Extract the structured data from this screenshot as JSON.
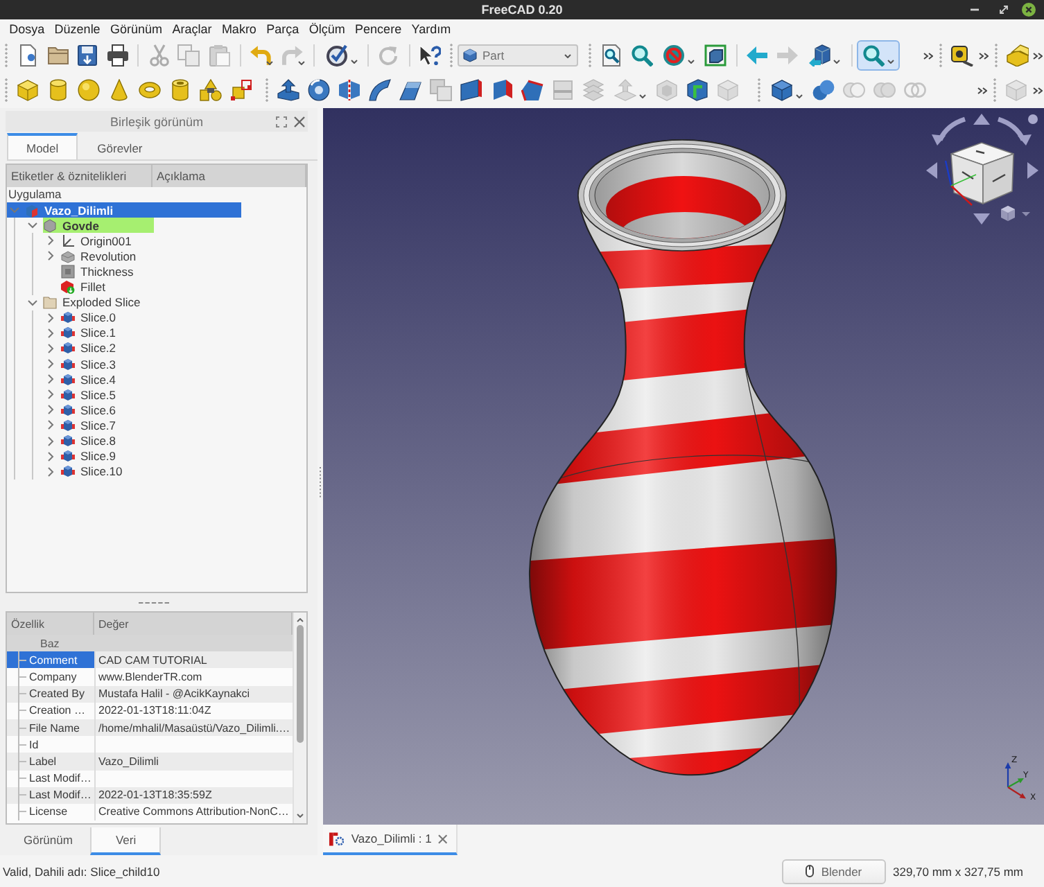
{
  "window": {
    "title": "FreeCAD 0.20"
  },
  "menu": [
    "Dosya",
    "Düzenle",
    "Görünüm",
    "Araçlar",
    "Makro",
    "Parça",
    "Ölçüm",
    "Pencere",
    "Yardım"
  ],
  "toolbar_rows": [
    [
      {
        "overflow": false,
        "items": [
          {
            "kind": "button",
            "disabled": false,
            "pressed": false
          },
          {
            "kind": "button",
            "disabled": false,
            "pressed": false
          },
          {
            "kind": "button",
            "disabled": false,
            "pressed": false
          },
          {
            "kind": "button",
            "disabled": false,
            "pressed": false
          },
          {
            "kind": "separator"
          },
          {
            "kind": "button",
            "disabled": true,
            "pressed": false
          },
          {
            "kind": "button",
            "disabled": true,
            "pressed": false
          },
          {
            "kind": "button",
            "disabled": true,
            "pressed": false
          },
          {
            "kind": "separator"
          },
          {
            "kind": "split_button",
            "disabled": false,
            "pressed": false
          },
          {
            "kind": "split_button",
            "disabled": true,
            "pressed": false
          },
          {
            "kind": "separator"
          },
          {
            "kind": "menu_button",
            "disabled": false,
            "pressed": false
          },
          {
            "kind": "separator"
          },
          {
            "kind": "button",
            "disabled": true,
            "pressed": false
          },
          {
            "kind": "separator"
          },
          {
            "kind": "button",
            "disabled": false,
            "pressed": false
          }
        ]
      },
      {
        "overflow": false,
        "items": [
          {
            "kind": "selector",
            "value": "Part"
          }
        ]
      },
      {
        "overflow": true,
        "items": [
          {
            "kind": "button",
            "disabled": false,
            "pressed": false
          },
          {
            "kind": "button",
            "disabled": false,
            "pressed": false
          },
          {
            "kind": "menu_button",
            "disabled": false,
            "pressed": false
          },
          {
            "kind": "button",
            "disabled": false,
            "pressed": false
          },
          {
            "kind": "separator"
          },
          {
            "kind": "button",
            "disabled": false,
            "pressed": false
          },
          {
            "kind": "button",
            "disabled": true,
            "pressed": false
          },
          {
            "kind": "menu_button",
            "disabled": false,
            "pressed": false
          },
          {
            "kind": "separator"
          },
          {
            "kind": "menu_button",
            "disabled": false,
            "pressed": true
          }
        ]
      },
      {
        "overflow": true,
        "items": [
          {
            "kind": "button",
            "disabled": false,
            "pressed": false
          }
        ]
      },
      {
        "overflow": true,
        "items": [
          {
            "kind": "button",
            "disabled": false,
            "pressed": false
          }
        ]
      }
    ],
    [
      {
        "overflow": false,
        "items": [
          {
            "kind": "button",
            "disabled": false,
            "pressed": false
          },
          {
            "kind": "button",
            "disabled": false,
            "pressed": false
          },
          {
            "kind": "button",
            "disabled": false,
            "pressed": false
          },
          {
            "kind": "button",
            "disabled": false,
            "pressed": false
          },
          {
            "kind": "button",
            "disabled": false,
            "pressed": false
          },
          {
            "kind": "button",
            "disabled": false,
            "pressed": false
          },
          {
            "kind": "button",
            "disabled": false,
            "pressed": false
          },
          {
            "kind": "button",
            "disabled": false,
            "pressed": false
          }
        ]
      },
      {
        "overflow": false,
        "items": [
          {
            "kind": "button",
            "disabled": false,
            "pressed": false
          },
          {
            "kind": "button",
            "disabled": false,
            "pressed": false
          },
          {
            "kind": "button",
            "disabled": false,
            "pressed": false
          },
          {
            "kind": "button",
            "disabled": false,
            "pressed": false
          },
          {
            "kind": "button",
            "disabled": false,
            "pressed": false
          },
          {
            "kind": "button",
            "disabled": true,
            "pressed": false
          },
          {
            "kind": "button",
            "disabled": false,
            "pressed": false
          },
          {
            "kind": "button",
            "disabled": false,
            "pressed": false
          },
          {
            "kind": "button",
            "disabled": false,
            "pressed": false
          },
          {
            "kind": "button",
            "disabled": true,
            "pressed": false
          },
          {
            "kind": "button",
            "disabled": true,
            "pressed": false
          },
          {
            "kind": "menu_button",
            "disabled": true,
            "pressed": false
          },
          {
            "kind": "button",
            "disabled": true,
            "pressed": false
          },
          {
            "kind": "button",
            "disabled": false,
            "pressed": false
          },
          {
            "kind": "button",
            "disabled": true,
            "pressed": false
          }
        ]
      },
      {
        "overflow": true,
        "items": [
          {
            "kind": "menu_button",
            "disabled": false,
            "pressed": false
          },
          {
            "kind": "button",
            "disabled": false,
            "pressed": false
          },
          {
            "kind": "button",
            "disabled": true,
            "pressed": false
          },
          {
            "kind": "button",
            "disabled": true,
            "pressed": false
          },
          {
            "kind": "button",
            "disabled": true,
            "pressed": false
          }
        ]
      },
      {
        "overflow": true,
        "items": [
          {
            "kind": "button",
            "disabled": true,
            "pressed": false
          }
        ]
      }
    ]
  ],
  "combo_view": {
    "title": "Birleşik görünüm",
    "tabs": [
      {
        "label": "Model",
        "selected": true
      },
      {
        "label": "Görevler",
        "selected": false
      }
    ],
    "tree": {
      "columns": [
        "Etiketler & öznitelikleri",
        "Açıklama"
      ],
      "root": "Uygulama",
      "items": [
        {
          "label": "Vazo_Dilimli",
          "kind": "part",
          "selected": true,
          "active": true,
          "expanded": true,
          "children": [
            {
              "label": "Govde",
              "kind": "body",
              "selected": false,
              "active": true,
              "expanded": true,
              "children": [
                {
                  "label": "Origin001",
                  "kind": "origin",
                  "selected": false,
                  "active": false,
                  "expanded": false
                },
                {
                  "label": "Revolution",
                  "kind": "revolution",
                  "selected": false,
                  "active": false,
                  "expanded": false
                },
                {
                  "label": "Thickness",
                  "kind": "thickness",
                  "selected": false,
                  "active": false
                },
                {
                  "label": "Fillet",
                  "kind": "fillet",
                  "selected": false,
                  "active": false
                }
              ]
            },
            {
              "label": "Exploded Slice",
              "kind": "folder",
              "selected": false,
              "active": false,
              "expanded": true,
              "children": [
                {
                  "label": "Slice.0",
                  "kind": "slice",
                  "selected": false,
                  "active": false,
                  "expanded": false
                },
                {
                  "label": "Slice.1",
                  "kind": "slice",
                  "selected": false,
                  "active": false,
                  "expanded": false
                },
                {
                  "label": "Slice.2",
                  "kind": "slice",
                  "selected": false,
                  "active": false,
                  "expanded": false
                },
                {
                  "label": "Slice.3",
                  "kind": "slice",
                  "selected": false,
                  "active": false,
                  "expanded": false
                },
                {
                  "label": "Slice.4",
                  "kind": "slice",
                  "selected": false,
                  "active": false,
                  "expanded": false
                },
                {
                  "label": "Slice.5",
                  "kind": "slice",
                  "selected": false,
                  "active": false,
                  "expanded": false
                },
                {
                  "label": "Slice.6",
                  "kind": "slice",
                  "selected": false,
                  "active": false,
                  "expanded": false
                },
                {
                  "label": "Slice.7",
                  "kind": "slice",
                  "selected": false,
                  "active": false,
                  "expanded": false
                },
                {
                  "label": "Slice.8",
                  "kind": "slice",
                  "selected": false,
                  "active": false,
                  "expanded": false
                },
                {
                  "label": "Slice.9",
                  "kind": "slice",
                  "selected": false,
                  "active": false,
                  "expanded": false
                },
                {
                  "label": "Slice.10",
                  "kind": "slice",
                  "selected": false,
                  "active": false,
                  "expanded": false
                }
              ]
            }
          ]
        }
      ]
    }
  },
  "property_view": {
    "columns": [
      "Özellik",
      "Değer"
    ],
    "groups": [
      {
        "name": "Baz",
        "rows": [
          {
            "name": "Comment",
            "value": "CAD CAM TUTORIAL",
            "selected": true
          },
          {
            "name": "Company",
            "value": "www.BlenderTR.com",
            "selected": false
          },
          {
            "name": "Created By",
            "value": "Mustafa Halil - @AcikKaynakci",
            "selected": false
          },
          {
            "name": "Creation …",
            "value": "2022-01-13T18:11:04Z",
            "selected": false
          },
          {
            "name": "File Name",
            "value": "/home/mhalil/Masaüstü/Vazo_Dilimli.…",
            "selected": false
          },
          {
            "name": "Id",
            "selected": false
          },
          {
            "name": "Label",
            "value": "Vazo_Dilimli",
            "selected": false
          },
          {
            "name": "Last Modif…",
            "selected": false
          },
          {
            "name": "Last Modif…",
            "value": "2022-01-13T18:35:59Z",
            "selected": false
          },
          {
            "name": "License",
            "value": "Creative Commons Attribution-NonC…",
            "selected": false
          }
        ]
      }
    ],
    "tabs": [
      {
        "label": "Görünüm",
        "selected": false
      },
      {
        "label": "Veri",
        "selected": true
      }
    ]
  },
  "viewport": {
    "axis_labels": [
      "Z",
      "Y",
      "X"
    ]
  },
  "document_tabs": [
    {
      "label": "Vazo_Dilimli : 1",
      "selected": true
    }
  ],
  "status_bar": {
    "message": "Valid, Dahili adı: Slice_child10",
    "navigation_style": "Blender",
    "dimensions": "329,70 mm x 327,75 mm"
  }
}
